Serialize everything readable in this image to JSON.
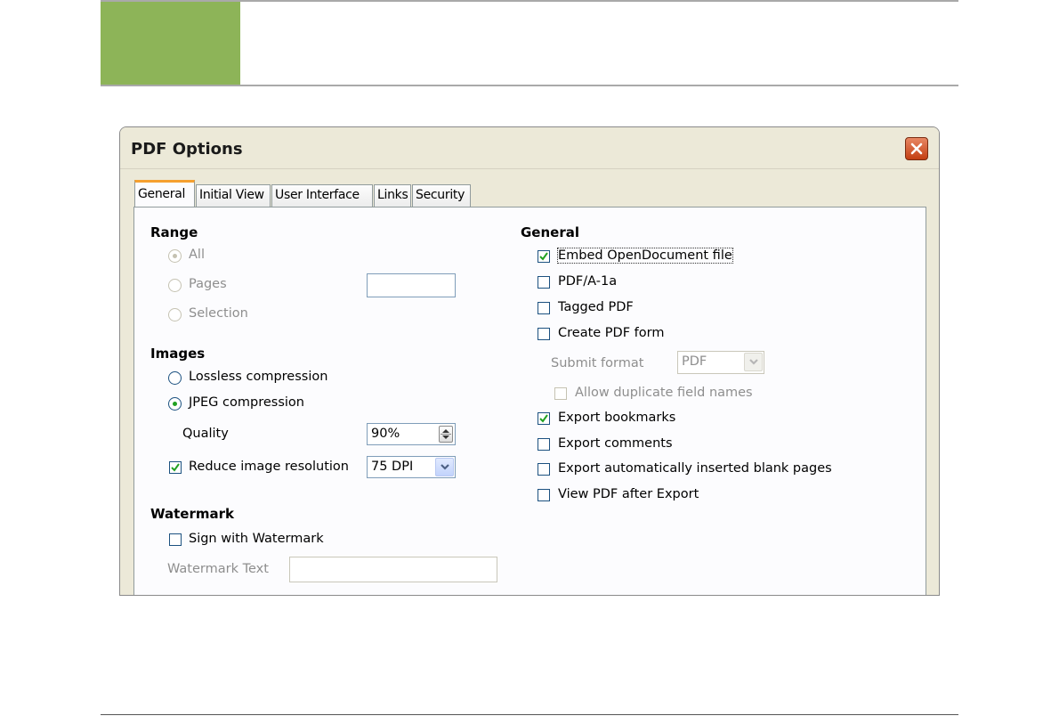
{
  "dialog": {
    "title": "PDF Options",
    "tabs": [
      {
        "label": "General",
        "active": true
      },
      {
        "label": "Initial View"
      },
      {
        "label": "User Interface"
      },
      {
        "label": "Links"
      },
      {
        "label": "Security"
      }
    ]
  },
  "range": {
    "heading": "Range",
    "all_label": "All",
    "pages_label": "Pages",
    "pages_value": "",
    "selection_label": "Selection",
    "selected": "All"
  },
  "images": {
    "heading": "Images",
    "lossless_label": "Lossless compression",
    "jpeg_label": "JPEG compression",
    "selected": "JPEG compression",
    "quality_label": "Quality",
    "quality_value": "90%",
    "reduce_label": "Reduce image resolution",
    "reduce_checked": true,
    "resolution_value": "75 DPI"
  },
  "watermark": {
    "heading": "Watermark",
    "sign_label": "Sign with Watermark",
    "sign_checked": false,
    "text_label": "Watermark Text",
    "text_value": ""
  },
  "general": {
    "heading": "General",
    "embed_label": "Embed OpenDocument file",
    "embed_checked": true,
    "pdfa_label": "PDF/A-1a",
    "tagged_label": "Tagged PDF",
    "form_label": "Create PDF form",
    "submit_label": "Submit format",
    "submit_value": "PDF",
    "dup_label": "Allow duplicate field names",
    "bookmarks_label": "Export bookmarks",
    "bookmarks_checked": true,
    "comments_label": "Export comments",
    "blank_label": "Export automatically inserted blank pages",
    "view_label": "View PDF after Export"
  },
  "colors": {
    "accent_green": "#8db458",
    "tab_highlight": "#f5a02f",
    "close_red": "#c33e12",
    "check_green": "#21a121"
  }
}
